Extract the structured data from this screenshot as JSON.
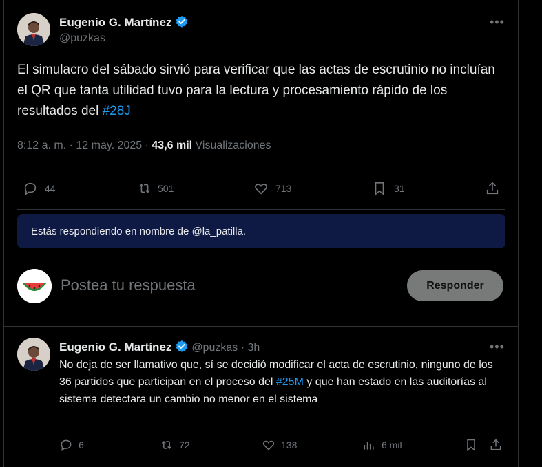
{
  "main_tweet": {
    "author_name": "Eugenio G. Martínez",
    "author_handle": "@puzkas",
    "text_part1": "El simulacro del sábado sirvió para verificar que las actas de escrutinio no incluían el QR que tanta utilidad tuvo para la lectura y procesamiento rápido de los resultados del ",
    "hashtag": "#28J",
    "time": "8:12 a. m.",
    "date": "12 may. 2025",
    "views_count": "43,6 mil",
    "views_label": "Visualizaciones",
    "stats": {
      "replies": "44",
      "reposts": "501",
      "likes": "713",
      "bookmarks": "31"
    }
  },
  "reply_banner": {
    "text": "Estás respondiendo en nombre de @la_patilla."
  },
  "composer": {
    "placeholder": "Postea tu respuesta",
    "button_label": "Responder"
  },
  "reply_tweet": {
    "author_name": "Eugenio G. Martínez",
    "author_handle": "@puzkas",
    "time_ago": "3h",
    "text_part1": "No deja de ser llamativo que, sí se decidió modificar el acta de escrutinio, ninguno de los 36 partidos que participan en el proceso del ",
    "hashtag": "#25M",
    "text_part2": " y que han estado en las auditorías al sistema detectara un cambio no menor en el sistema",
    "stats": {
      "replies": "6",
      "reposts": "72",
      "likes": "138",
      "views": "6 mil"
    }
  },
  "colors": {
    "background": "#000000",
    "accent": "#1d9bf0",
    "muted": "#71767b",
    "banner": "#0f1a44"
  }
}
